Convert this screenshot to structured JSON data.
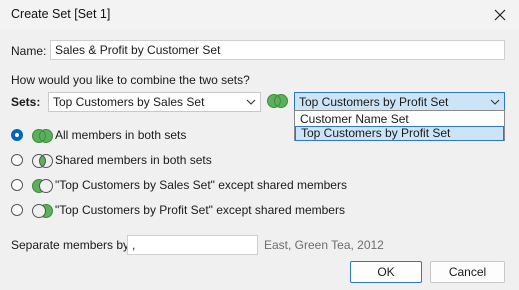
{
  "window": {
    "title": "Create Set [Set 1]",
    "close_icon": "close-icon"
  },
  "name": {
    "label": "Name:",
    "value": "Sales & Profit by Customer Set"
  },
  "combine_question": "How would you like to combine the two sets?",
  "sets": {
    "label": "Sets:",
    "left_value": "Top Customers by Sales Set",
    "right_value": "Top Customers by Profit Set",
    "dropdown_options": [
      "Customer Name Set",
      "Top Customers by Profit Set"
    ],
    "selected_option_index": 1
  },
  "options": [
    {
      "label": "All members in both sets",
      "selected": true,
      "icon": "venn-union-icon"
    },
    {
      "label": "Shared members in both sets",
      "selected": false,
      "icon": "venn-intersection-icon"
    },
    {
      "label": "\"Top Customers by Sales Set\" except shared members",
      "selected": false,
      "icon": "venn-left-except-icon"
    },
    {
      "label": "\"Top Customers by Profit Set\" except shared members",
      "selected": false,
      "icon": "venn-right-except-icon"
    }
  ],
  "separator": {
    "label": "Separate members by",
    "value": ",",
    "example": "East, Green Tea, 2012"
  },
  "buttons": {
    "ok": "OK",
    "cancel": "Cancel"
  },
  "colors": {
    "venn_green": "#5bb05b",
    "accent_blue": "#0067c0",
    "selection_fill": "#cce4f7"
  }
}
